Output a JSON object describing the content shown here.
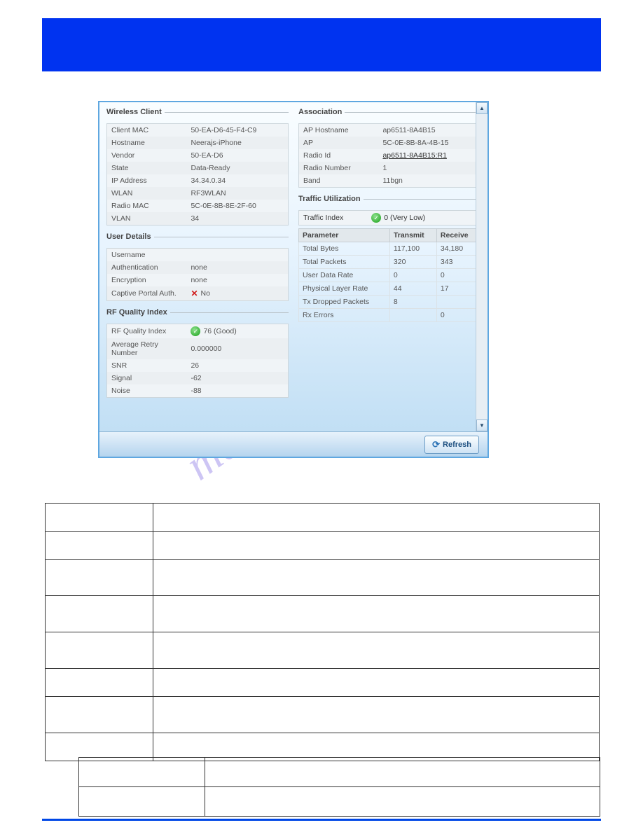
{
  "sections": {
    "wireless_client": "Wireless Client",
    "user_details": "User Details",
    "rf_quality": "RF Quality Index",
    "association": "Association",
    "traffic": "Traffic Utilization"
  },
  "wireless_client": {
    "rows": [
      {
        "k": "Client MAC",
        "v": "50-EA-D6-45-F4-C9"
      },
      {
        "k": "Hostname",
        "v": "Neerajs-iPhone"
      },
      {
        "k": "Vendor",
        "v": "50-EA-D6"
      },
      {
        "k": "State",
        "v": "Data-Ready"
      },
      {
        "k": "IP Address",
        "v": "34.34.0.34"
      },
      {
        "k": "WLAN",
        "v": "RF3WLAN"
      },
      {
        "k": "Radio MAC",
        "v": "5C-0E-8B-8E-2F-60"
      },
      {
        "k": "VLAN",
        "v": "34"
      }
    ]
  },
  "user_details": {
    "rows": [
      {
        "k": "Username",
        "v": ""
      },
      {
        "k": "Authentication",
        "v": "none"
      },
      {
        "k": "Encryption",
        "v": "none"
      }
    ],
    "captive_label": "Captive Portal Auth.",
    "captive_value": "No"
  },
  "rf_quality": {
    "rows": [
      {
        "k": "Average Retry Number",
        "v": "0.000000"
      },
      {
        "k": "SNR",
        "v": "26"
      },
      {
        "k": "Signal",
        "v": "-62"
      },
      {
        "k": "Noise",
        "v": "-88"
      }
    ],
    "index_label": "RF Quality Index",
    "index_value": "76 (Good)"
  },
  "association": {
    "rows": [
      {
        "k": "AP Hostname",
        "v": "ap6511-8A4B15"
      },
      {
        "k": "AP",
        "v": "5C-0E-8B-8A-4B-15"
      },
      {
        "k": "Radio Id",
        "v": "ap6511-8A4B15:R1",
        "link": true
      },
      {
        "k": "Radio Number",
        "v": "1"
      },
      {
        "k": "Band",
        "v": "11bgn"
      }
    ]
  },
  "traffic": {
    "index_label": "Traffic Index",
    "index_value": "0 (Very Low)",
    "headers": {
      "param": "Parameter",
      "tx": "Transmit",
      "rx": "Receive"
    },
    "rows": [
      {
        "p": "Total Bytes",
        "t": "117,100",
        "r": "34,180"
      },
      {
        "p": "Total Packets",
        "t": "320",
        "r": "343"
      },
      {
        "p": "User Data Rate",
        "t": "0",
        "r": "0"
      },
      {
        "p": "Physical Layer Rate",
        "t": "44",
        "r": "17"
      },
      {
        "p": "Tx Dropped Packets",
        "t": "8",
        "r": ""
      },
      {
        "p": "Rx Errors",
        "t": "",
        "r": "0"
      }
    ]
  },
  "buttons": {
    "refresh": "Refresh"
  },
  "watermark": "manualshive.com"
}
